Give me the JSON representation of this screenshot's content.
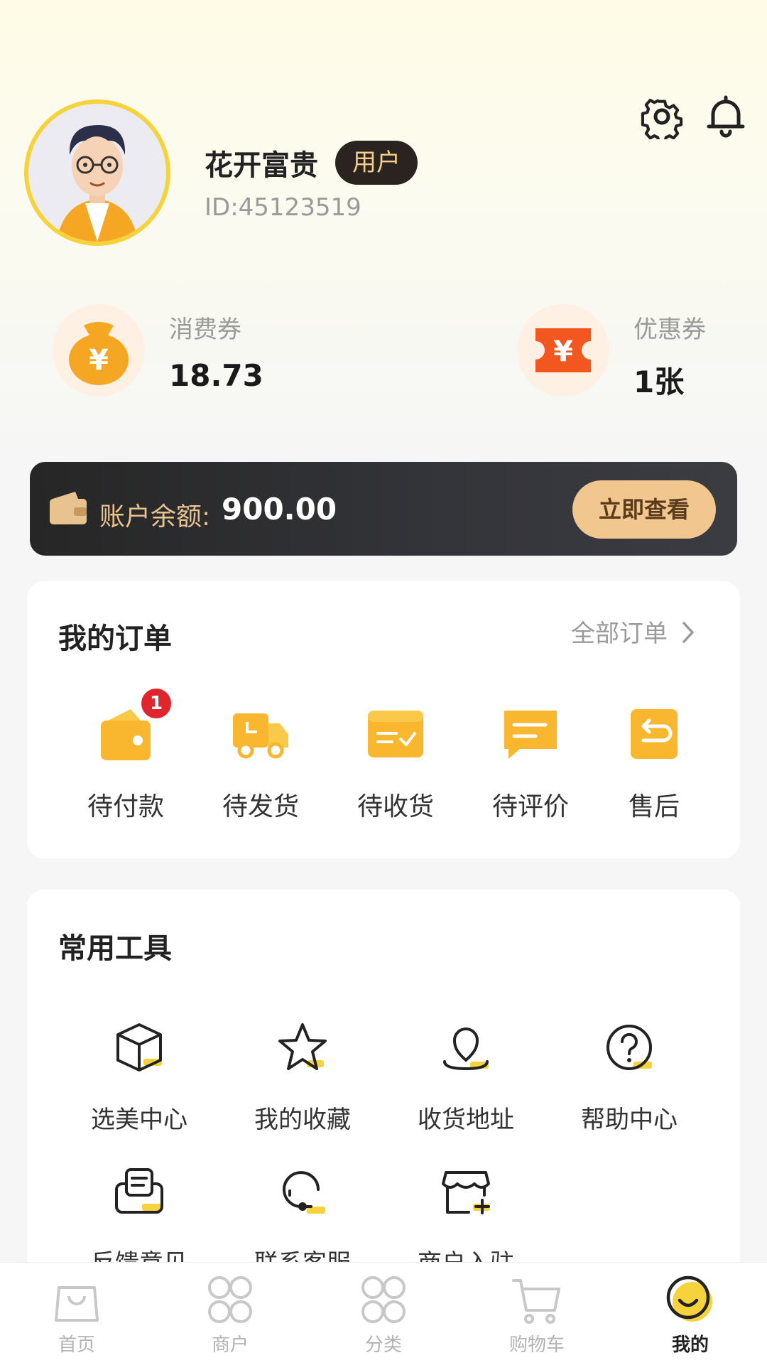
{
  "profile": {
    "name": "花开富贵",
    "role": "用户",
    "id": "ID:45123519"
  },
  "header_icons": [
    "gear-icon",
    "bell-icon"
  ],
  "wallet": {
    "consumption_label": "消费券",
    "consumption_value": "18.73",
    "coupon_label": "优惠券",
    "coupon_value": "1张"
  },
  "balance": {
    "label": "账户余额:",
    "value": "900.00",
    "button": "立即查看"
  },
  "orders": {
    "title": "我的订单",
    "all_link": "全部订单",
    "items": [
      {
        "label": "待付款",
        "icon": "wallet-icon",
        "badge": "1"
      },
      {
        "label": "待发货",
        "icon": "truck-icon"
      },
      {
        "label": "待收货",
        "icon": "package-icon"
      },
      {
        "label": "待评价",
        "icon": "comment-icon"
      },
      {
        "label": "售后",
        "icon": "return-icon"
      }
    ]
  },
  "tools": {
    "title": "常用工具",
    "items": [
      {
        "label": "选美中心",
        "icon": "cube-icon"
      },
      {
        "label": "我的收藏",
        "icon": "star-icon"
      },
      {
        "label": "收货地址",
        "icon": "location-icon"
      },
      {
        "label": "帮助中心",
        "icon": "help-icon"
      },
      {
        "label": "反馈意见",
        "icon": "feedback-icon"
      },
      {
        "label": "联系客服",
        "icon": "headset-icon"
      },
      {
        "label": "商户入驻",
        "icon": "store-icon"
      }
    ]
  },
  "tabbar": {
    "items": [
      {
        "label": "首页",
        "icon": "bag-icon"
      },
      {
        "label": "商户",
        "icon": "merchant-icon"
      },
      {
        "label": "分类",
        "icon": "category-icon"
      },
      {
        "label": "购物车",
        "icon": "cart-icon"
      },
      {
        "label": "我的",
        "icon": "smile-icon"
      }
    ],
    "active": "我的"
  },
  "colors": {
    "accent_yellow": "#f6d33c",
    "orange": "#f5a623",
    "dark_bar": "#2b2b2f",
    "button_gold": "#f1c68f",
    "badge_red": "#e0262c"
  }
}
